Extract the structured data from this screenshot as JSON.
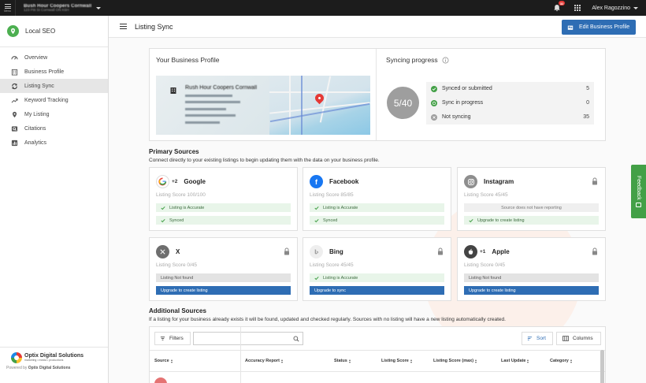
{
  "topbar": {
    "menu_label": "Menu",
    "business_name": "Bush Hour Coopers Cornwall",
    "business_address": "123 Pitt St Cornwall ON K6H",
    "notification_count": "32",
    "user_name": "Alex Ragozzino"
  },
  "sidebar": {
    "brand_name": "Local SEO",
    "items": [
      {
        "label": "Overview",
        "icon": "speedometer-icon",
        "active": false
      },
      {
        "label": "Business Profile",
        "icon": "building-icon",
        "active": false
      },
      {
        "label": "Listing Sync",
        "icon": "sync-icon",
        "active": true
      },
      {
        "label": "Keyword Tracking",
        "icon": "trending-up-icon",
        "active": false
      },
      {
        "label": "My Listing",
        "icon": "map-pin-icon",
        "active": false
      },
      {
        "label": "Citations",
        "icon": "search-card-icon",
        "active": false
      },
      {
        "label": "Analytics",
        "icon": "bar-chart-icon",
        "active": false
      }
    ],
    "footer": {
      "company_name": "Optix Digital Solutions",
      "company_tagline": "marketing • media • productions",
      "powered_by_prefix": "Powered by",
      "powered_by_name": "Optix Digital Solutions"
    }
  },
  "header": {
    "title": "Listing Sync",
    "edit_button": "Edit Business Profile"
  },
  "profile": {
    "title": "Your Business Profile",
    "map_business_name": "Rush Hour Coopers Cornwall"
  },
  "syncing": {
    "title": "Syncing progress",
    "progress_text": "5/40",
    "rows": [
      {
        "label": "Synced or submitted",
        "count": "5"
      },
      {
        "label": "Sync in progress",
        "count": "0"
      },
      {
        "label": "Not syncing",
        "count": "35"
      }
    ]
  },
  "primary": {
    "title": "Primary Sources",
    "description": "Connect directly to your existing listings to begin updating them with the data on your business profile.",
    "cards": [
      {
        "name": "Google",
        "plus": "+2",
        "score": "Listing Score 100/100",
        "bar1": "Listing is Accurate",
        "bar2": "Synced"
      },
      {
        "name": "Facebook",
        "score": "Listing Score 85/85",
        "bar1": "Listing is Accurate",
        "bar2": "Synced"
      },
      {
        "name": "Instagram",
        "score": "Listing Score 45/45",
        "bar1": "Source does not have reporting",
        "bar2": "Upgrade to create listing"
      },
      {
        "name": "X",
        "score": "Listing Score 0/45",
        "bar1": "Listing Not found",
        "bar2": "Upgrade to create listing"
      },
      {
        "name": "Bing",
        "score": "Listing Score 45/45",
        "bar1": "Listing is Accurate",
        "bar2": "Upgrade to sync"
      },
      {
        "name": "Apple",
        "plus": "+1",
        "score": "Listing Score 0/45",
        "bar1": "Listing Not found",
        "bar2": "Upgrade to create listing"
      }
    ]
  },
  "additional": {
    "title": "Additional Sources",
    "description": "If a listing for your business already exists it will be found, updated and checked regularly. Sources with no listing will have a new listing automatically created.",
    "filters_label": "Filters",
    "search_placeholder": "",
    "sort_label": "Sort",
    "columns_label": "Columns",
    "headers": [
      "Source",
      "Accuracy Report",
      "Status",
      "Listing Score",
      "Listing Score (max)",
      "Last Update",
      "Category"
    ]
  },
  "feedback_label": "Feedback",
  "colors": {
    "primary_blue": "#2e6db4",
    "success_green": "#43a047",
    "topbar": "#1c1c1c"
  }
}
